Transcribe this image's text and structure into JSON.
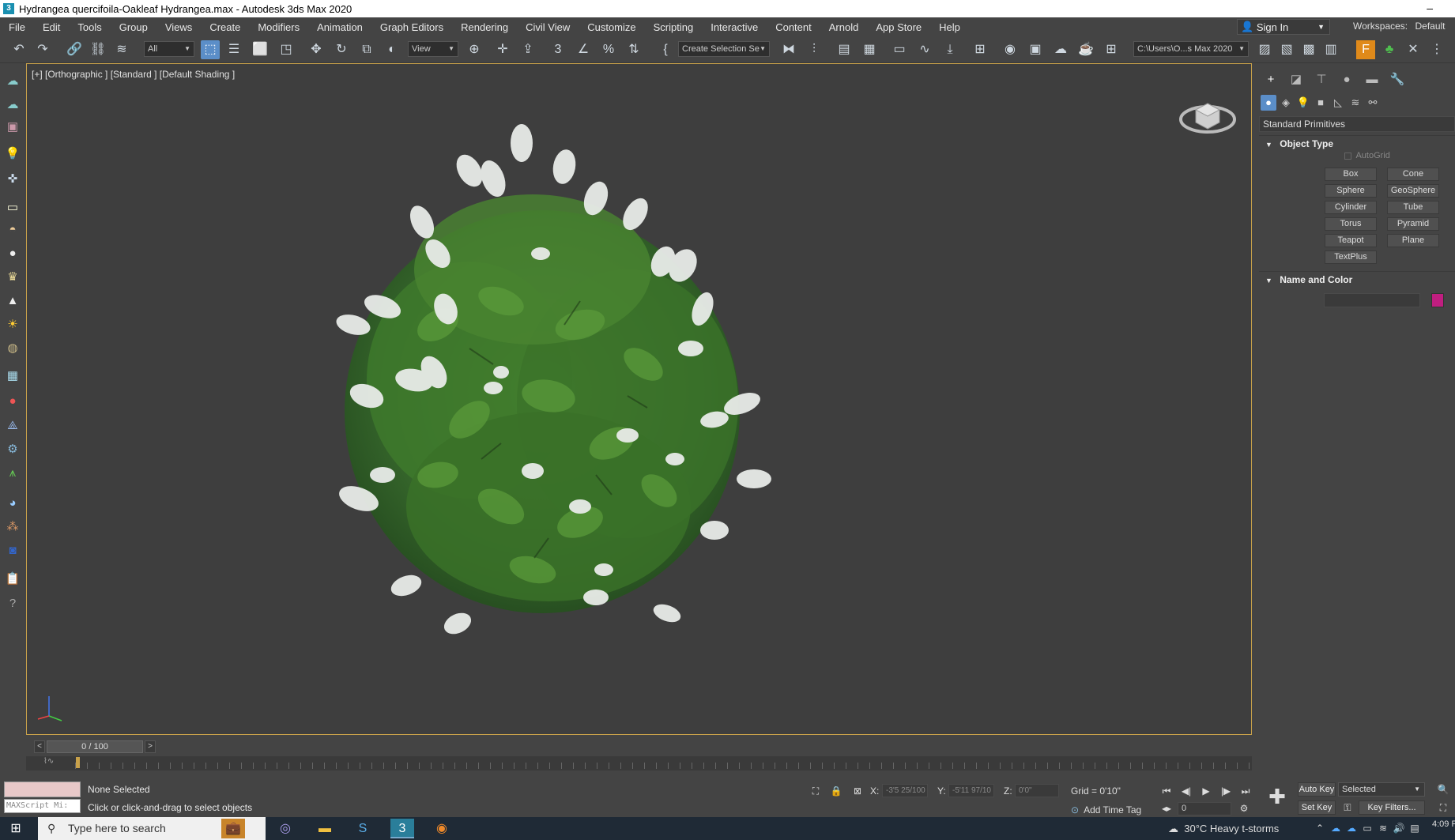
{
  "window": {
    "title": "Hydrangea quercifoila-Oakleaf Hydrangea.max - Autodesk 3ds Max 2020",
    "minimize_glyph": "–"
  },
  "menu": [
    "File",
    "Edit",
    "Tools",
    "Group",
    "Views",
    "Create",
    "Modifiers",
    "Animation",
    "Graph Editors",
    "Rendering",
    "Civil View",
    "Customize",
    "Scripting",
    "Interactive",
    "Content",
    "Arnold",
    "App Store",
    "Help"
  ],
  "account": {
    "signin_label": "Sign In",
    "workspaces_label": "Workspaces:",
    "workspace_value": "Default"
  },
  "toolbar": {
    "filter_value": "All",
    "refcoord_value": "View",
    "selection_set_placeholder": "Create Selection Se",
    "project_path": "C:\\Users\\O...s Max 2020"
  },
  "viewport": {
    "label": "[+] [Orthographic ] [Standard ] [Default Shading ]"
  },
  "command_panel": {
    "category": "Standard Primitives",
    "object_type_title": "Object Type",
    "autogrid_label": "AutoGrid",
    "objects": [
      "Box",
      "Cone",
      "Sphere",
      "GeoSphere",
      "Cylinder",
      "Tube",
      "Torus",
      "Pyramid",
      "Teapot",
      "Plane",
      "TextPlus"
    ],
    "name_color_title": "Name and Color",
    "object_color": "#c01e80"
  },
  "timeline": {
    "frame_display": "0 / 100",
    "prev": "<",
    "next": ">"
  },
  "status": {
    "maxscript_placeholder": "MAXScript Mi:",
    "selection": "None Selected",
    "prompt": "Click or click-and-drag to select objects",
    "x_label": "X:",
    "x_value": "-3'5 25/100",
    "y_label": "Y:",
    "y_value": "-5'11 97/10",
    "z_label": "Z:",
    "z_value": "0'0\"",
    "grid": "Grid = 0'10\"",
    "add_time_tag": "Add Time Tag",
    "frame_spinner": "0",
    "auto_key": "Auto Key",
    "set_key": "Set Key",
    "selected_dropdown": "Selected",
    "key_filters": "Key Filters..."
  },
  "taskbar": {
    "search_placeholder": "Type here to search",
    "weather": "30°C  Heavy t-storms",
    "clock": "4:09 P"
  },
  "colors": {
    "viewport_border": "#c8a14a",
    "accent": "#5b8ec8"
  }
}
